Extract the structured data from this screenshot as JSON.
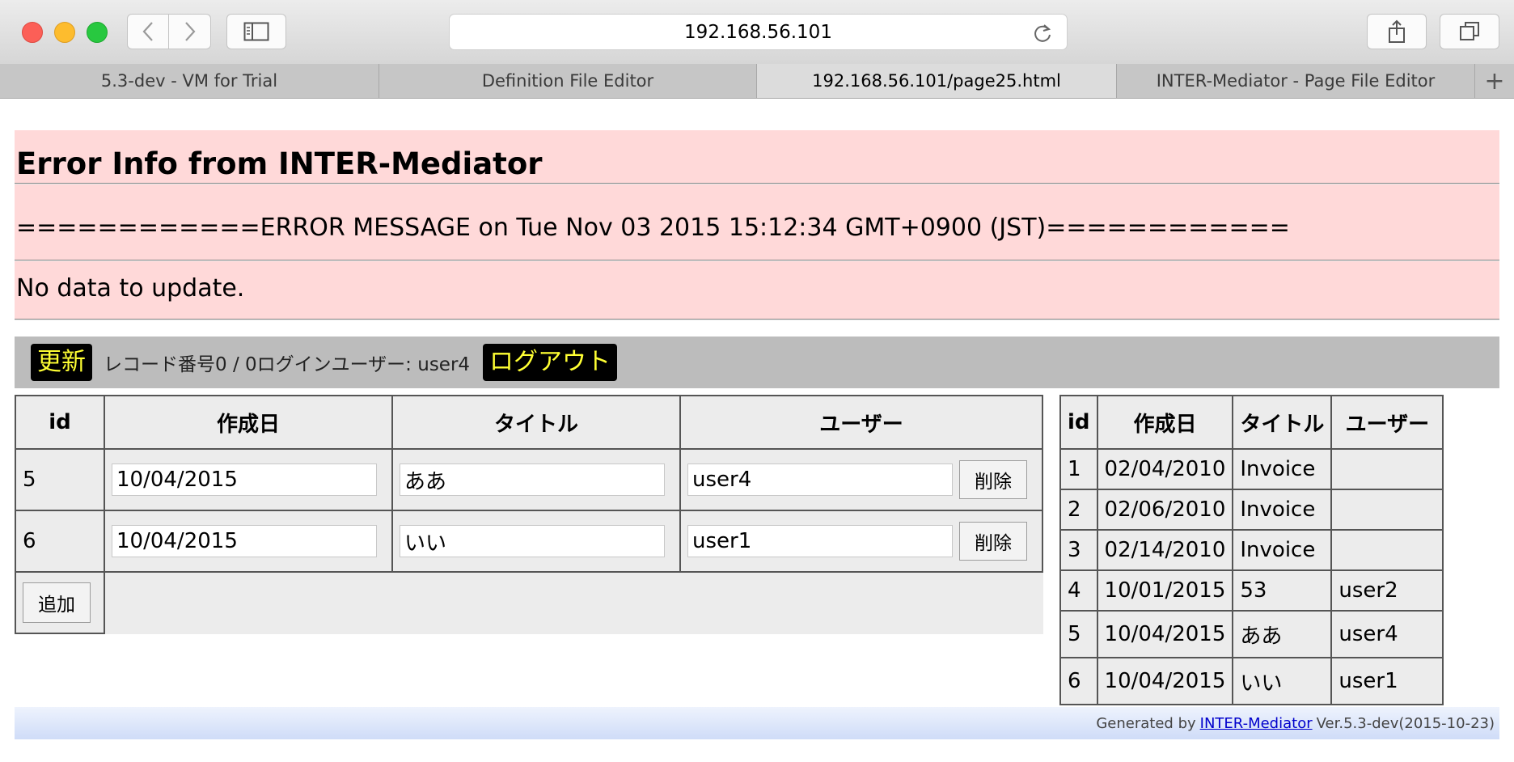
{
  "browser": {
    "address": "192.168.56.101",
    "tabs": [
      {
        "label": "5.3-dev - VM for Trial",
        "active": false
      },
      {
        "label": "Definition File Editor",
        "active": false
      },
      {
        "label": "192.168.56.101/page25.html",
        "active": true
      },
      {
        "label": "INTER-Mediator - Page File Editor",
        "active": false
      }
    ],
    "new_tab_label": "+",
    "icons": [
      "back-icon",
      "forward-icon",
      "sidebar-icon",
      "reload-icon",
      "share-icon",
      "tabs-overview-icon"
    ]
  },
  "error_panel": {
    "title": "Error Info from INTER-Mediator",
    "message": "============ERROR MESSAGE on Tue Nov 03 2015 15:12:34 GMT+0900 (JST)============",
    "detail": "No data to update."
  },
  "navigator": {
    "refresh_label": "更新",
    "record_info": "レコード番号0 / 0ログインユーザー: user4",
    "logout_label": "ログアウト"
  },
  "edit_table": {
    "headers": [
      "id",
      "作成日",
      "タイトル",
      "ユーザー"
    ],
    "rows": [
      {
        "id": "5",
        "date": "10/04/2015",
        "title": "ああ",
        "user": "user4"
      },
      {
        "id": "6",
        "date": "10/04/2015",
        "title": "いい",
        "user": "user1"
      }
    ],
    "delete_label": "削除",
    "add_label": "追加"
  },
  "list_table": {
    "headers": [
      "id",
      "作成日",
      "タイトル",
      "ユーザー"
    ],
    "rows": [
      {
        "id": "1",
        "date": "02/04/2010",
        "title": "Invoice",
        "user": ""
      },
      {
        "id": "2",
        "date": "02/06/2010",
        "title": "Invoice",
        "user": ""
      },
      {
        "id": "3",
        "date": "02/14/2010",
        "title": "Invoice",
        "user": ""
      },
      {
        "id": "4",
        "date": "10/01/2015",
        "title": "53",
        "user": "user2"
      },
      {
        "id": "5",
        "date": "10/04/2015",
        "title": "ああ",
        "user": "user4"
      },
      {
        "id": "6",
        "date": "10/04/2015",
        "title": "いい",
        "user": "user1"
      }
    ]
  },
  "footer": {
    "prefix": "Generated by",
    "link": "INTER-Mediator",
    "version": "Ver.5.3-dev(2015-10-23)"
  },
  "colors": {
    "error_bg": "#ffd9d9",
    "navigator_bg": "#bcbcbc",
    "nav_button_bg": "#000000",
    "nav_button_text": "#ffff33",
    "table_bg": "#ececec",
    "footer_link": "#0000cc"
  }
}
